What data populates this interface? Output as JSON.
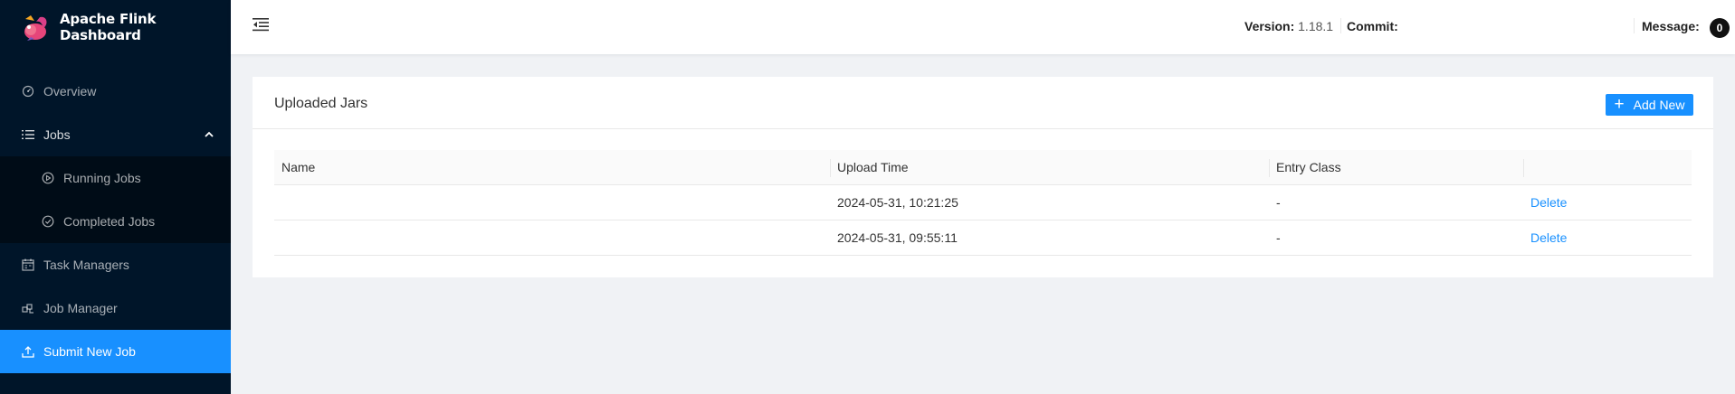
{
  "app": {
    "title": "Apache Flink Dashboard"
  },
  "sidebar": {
    "items": [
      {
        "label": "Overview",
        "icon": "dashboard-icon"
      },
      {
        "label": "Jobs",
        "icon": "list-icon",
        "expanded": true,
        "children": [
          {
            "label": "Running Jobs",
            "icon": "play-circle-icon"
          },
          {
            "label": "Completed Jobs",
            "icon": "check-circle-icon"
          }
        ]
      },
      {
        "label": "Task Managers",
        "icon": "schedule-icon"
      },
      {
        "label": "Job Manager",
        "icon": "build-icon"
      },
      {
        "label": "Submit New Job",
        "icon": "upload-icon",
        "active": true
      }
    ]
  },
  "header": {
    "version_label": "Version:",
    "version_value": "1.18.1",
    "commit_label": "Commit:",
    "commit_value": "",
    "message_label": "Message:",
    "message_count": "0"
  },
  "card": {
    "title": "Uploaded Jars",
    "add_button_label": "Add New"
  },
  "table": {
    "columns": [
      "Name",
      "Upload Time",
      "Entry Class",
      ""
    ],
    "rows": [
      {
        "name": "",
        "upload_time": "2024-05-31, 10:21:25",
        "entry_class": "-",
        "action": "Delete"
      },
      {
        "name": "",
        "upload_time": "2024-05-31, 09:55:11",
        "entry_class": "-",
        "action": "Delete"
      }
    ]
  },
  "colors": {
    "sidebar_bg": "#001529",
    "submenu_bg": "#000c17",
    "accent": "#1890ff",
    "page_bg": "#f0f2f5"
  }
}
